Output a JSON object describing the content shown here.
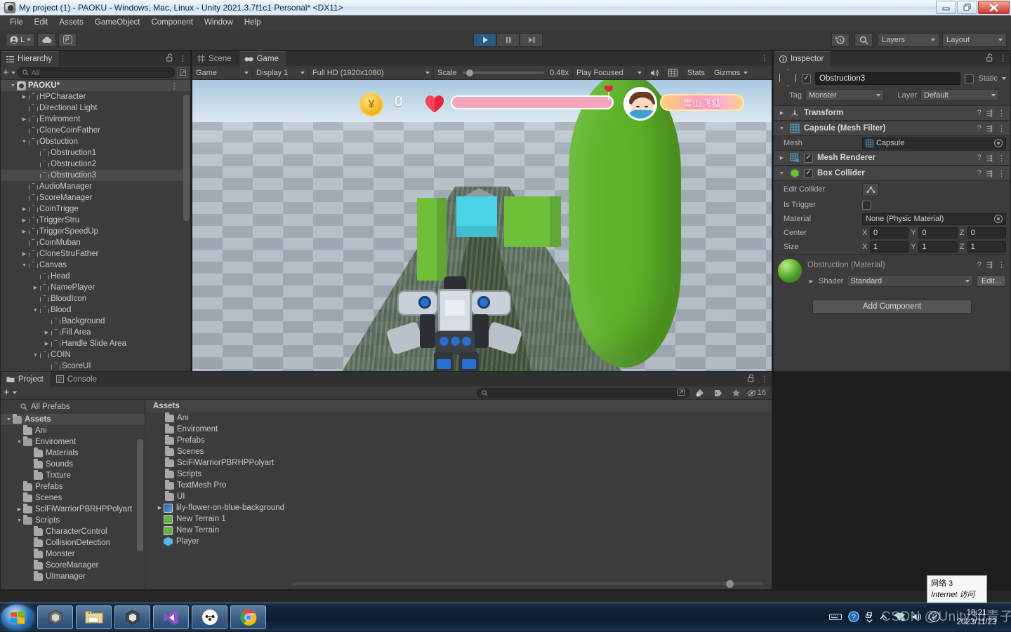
{
  "window": {
    "title": "My project (1) - PAOKU - Windows, Mac, Linux - Unity 2021.3.7f1c1 Personal* <DX11>",
    "minimize_label": "–",
    "restore_label": "❐",
    "close_label": "✕"
  },
  "menubar": {
    "items": [
      "File",
      "Edit",
      "Assets",
      "GameObject",
      "Component",
      "Window",
      "Help"
    ]
  },
  "toolbar": {
    "account_label": "L",
    "cloud_icon": "cloud-icon",
    "services_icon": "unity-services-icon",
    "play_icon": "▶",
    "pause_icon": "❚❚",
    "step_icon": "▶❚",
    "play_active": true,
    "history_icon": "undo-history-icon",
    "search_icon": "search-icon",
    "layers_label": "Layers",
    "layout_label": "Layout"
  },
  "hierarchy": {
    "tab_label": "Hierarchy",
    "tab_icon": "hierarchy-icon",
    "lock_icon": "lock-open-icon",
    "menu_icon": "kebab-menu-icon",
    "add_label": "+",
    "search_placeholder": "All",
    "items": [
      {
        "label": "PAOKU*",
        "depth": 0,
        "arrow": "down",
        "icon": "scene-icon",
        "selected": false,
        "root": true
      },
      {
        "label": "HPCharacter",
        "depth": 1,
        "arrow": "right",
        "icon": "gameobject-icon"
      },
      {
        "label": "Directional Light",
        "depth": 1,
        "arrow": "none",
        "icon": "gameobject-icon"
      },
      {
        "label": "Enviroment",
        "depth": 1,
        "arrow": "right",
        "icon": "gameobject-icon"
      },
      {
        "label": "CloneCoinFather",
        "depth": 1,
        "arrow": "none",
        "icon": "gameobject-icon"
      },
      {
        "label": "Obstuction",
        "depth": 1,
        "arrow": "down",
        "icon": "gameobject-icon"
      },
      {
        "label": "Obstruction1",
        "depth": 2,
        "arrow": "none",
        "icon": "gameobject-icon"
      },
      {
        "label": "Obstruction2",
        "depth": 2,
        "arrow": "none",
        "icon": "gameobject-icon"
      },
      {
        "label": "Obstruction3",
        "depth": 2,
        "arrow": "none",
        "icon": "gameobject-icon",
        "selected": true
      },
      {
        "label": "AudioManager",
        "depth": 1,
        "arrow": "none",
        "icon": "gameobject-icon"
      },
      {
        "label": "ScoreManager",
        "depth": 1,
        "arrow": "none",
        "icon": "gameobject-icon"
      },
      {
        "label": "CoinTrigge",
        "depth": 1,
        "arrow": "right",
        "icon": "gameobject-icon"
      },
      {
        "label": "TriggerStru",
        "depth": 1,
        "arrow": "right",
        "icon": "gameobject-icon"
      },
      {
        "label": "TriggerSpeedUp",
        "depth": 1,
        "arrow": "right",
        "icon": "gameobject-icon"
      },
      {
        "label": "CoinMuban",
        "depth": 1,
        "arrow": "none",
        "icon": "gameobject-icon"
      },
      {
        "label": "CloneStruFather",
        "depth": 1,
        "arrow": "right",
        "icon": "gameobject-icon"
      },
      {
        "label": "Canvas",
        "depth": 1,
        "arrow": "down",
        "icon": "gameobject-icon"
      },
      {
        "label": "Head",
        "depth": 2,
        "arrow": "none",
        "icon": "gameobject-icon"
      },
      {
        "label": "NamePlayer",
        "depth": 2,
        "arrow": "right",
        "icon": "gameobject-icon"
      },
      {
        "label": "BloodIcon",
        "depth": 2,
        "arrow": "none",
        "icon": "gameobject-icon"
      },
      {
        "label": "Blood",
        "depth": 2,
        "arrow": "down",
        "icon": "gameobject-icon"
      },
      {
        "label": "Background",
        "depth": 3,
        "arrow": "none",
        "icon": "gameobject-icon"
      },
      {
        "label": "Fill Area",
        "depth": 3,
        "arrow": "right",
        "icon": "gameobject-icon"
      },
      {
        "label": "Handle Slide Area",
        "depth": 3,
        "arrow": "right",
        "icon": "gameobject-icon"
      },
      {
        "label": "COIN",
        "depth": 2,
        "arrow": "down",
        "icon": "gameobject-icon"
      },
      {
        "label": "ScoreUI",
        "depth": 3,
        "arrow": "none",
        "icon": "gameobject-icon"
      }
    ]
  },
  "gameview": {
    "tabs": [
      {
        "label": "Scene",
        "icon": "scene-grid-icon",
        "active": false
      },
      {
        "label": "Game",
        "icon": "game-pad-icon",
        "active": true
      }
    ],
    "menu_icon": "kebab-menu-icon",
    "display_mode": "Game",
    "display_target": "Display 1",
    "resolution": "Full HD (1920x1080)",
    "scale_label": "Scale",
    "scale_value": "0.48x",
    "play_mode": "Play Focused",
    "mute_icon": "speaker-icon",
    "aspect_icon": "grid-icon",
    "stats_label": "Stats",
    "gizmos_label": "Gizmos",
    "hud": {
      "coin_icon": "¥",
      "score": "0",
      "heart_icon": "heart-icon",
      "health_percent": 100,
      "avatar_icon": "player-avatar-icon",
      "player_name": "雪山飞狐"
    }
  },
  "inspector": {
    "tab_label": "Inspector",
    "tab_icon": "info-icon",
    "lock_icon": "lock-open-icon",
    "menu_icon": "kebab-menu-icon",
    "object_enabled": true,
    "object_name": "Obstruction3",
    "static_label": "Static",
    "static_checked": false,
    "tag_label": "Tag",
    "tag_value": "Monster",
    "layer_label": "Layer",
    "layer_value": "Default",
    "components": [
      {
        "name": "Transform",
        "icon": "transform-icon",
        "expanded": false,
        "has_checkbox": false
      },
      {
        "name": "Capsule (Mesh Filter)",
        "icon": "mesh-filter-icon",
        "expanded": true,
        "has_checkbox": false
      },
      {
        "name": "Mesh Renderer",
        "icon": "mesh-renderer-icon",
        "expanded": false,
        "has_checkbox": true,
        "checked": true
      },
      {
        "name": "Box Collider",
        "icon": "box-collider-icon",
        "expanded": true,
        "has_checkbox": true,
        "checked": true
      }
    ],
    "mesh_label": "Mesh",
    "mesh_value": "Capsule",
    "edit_collider_label": "Edit Collider",
    "is_trigger_label": "Is Trigger",
    "is_trigger_checked": false,
    "material_label": "Material",
    "material_value": "None (Physic Material)",
    "center_label": "Center",
    "center": {
      "x": "0",
      "y": "0",
      "z": "0"
    },
    "size_label": "Size",
    "size": {
      "x": "1",
      "y": "1",
      "z": "1"
    },
    "material_block": {
      "title": "Obstruction (Material)",
      "shader_label": "Shader",
      "shader_value": "Standard",
      "edit_label": "Edit...",
      "ball_color": "#4ea32a"
    },
    "add_component_label": "Add Component",
    "help_icon": "help-icon",
    "preset_icon": "preset-icon",
    "kebab_icon": "kebab-menu-icon"
  },
  "project": {
    "tabs": [
      {
        "label": "Project",
        "icon": "folder-icon",
        "active": true
      },
      {
        "label": "Console",
        "icon": "console-icon",
        "active": false
      }
    ],
    "add_label": "+",
    "search_placeholder": "",
    "search_icon": "search-icon",
    "save_search_icon": "save-filter-icon",
    "type_filter_icon": "type-filter-icon",
    "label_filter_icon": "label-filter-icon",
    "favorite_icon": "star-icon",
    "hidden_count": "16",
    "hidden_icon": "eye-off-icon",
    "lock_icon": "lock-open-icon",
    "menu_icon": "kebab-menu-icon",
    "all_prefabs_label": "All Prefabs",
    "tree": [
      {
        "label": "Assets",
        "depth": 0,
        "arrow": "down",
        "selected": true
      },
      {
        "label": "Ani",
        "depth": 1,
        "arrow": "none"
      },
      {
        "label": "Enviroment",
        "depth": 1,
        "arrow": "down"
      },
      {
        "label": "Materials",
        "depth": 2,
        "arrow": "none"
      },
      {
        "label": "Sounds",
        "depth": 2,
        "arrow": "none"
      },
      {
        "label": "Trxture",
        "depth": 2,
        "arrow": "none"
      },
      {
        "label": "Prefabs",
        "depth": 1,
        "arrow": "none"
      },
      {
        "label": "Scenes",
        "depth": 1,
        "arrow": "none"
      },
      {
        "label": "SciFiWarriorPBRHPPolyart",
        "depth": 1,
        "arrow": "right"
      },
      {
        "label": "Scripts",
        "depth": 1,
        "arrow": "down"
      },
      {
        "label": "CharacterControl",
        "depth": 2,
        "arrow": "none"
      },
      {
        "label": "CollisionDetection",
        "depth": 2,
        "arrow": "none"
      },
      {
        "label": "Monster",
        "depth": 2,
        "arrow": "none"
      },
      {
        "label": "ScoreManager",
        "depth": 2,
        "arrow": "none"
      },
      {
        "label": "UImanager",
        "depth": 2,
        "arrow": "none"
      }
    ],
    "breadcrumb": "Assets",
    "assets": [
      {
        "label": "Ani",
        "type": "folder"
      },
      {
        "label": "Enviroment",
        "type": "folder"
      },
      {
        "label": "Prefabs",
        "type": "folder"
      },
      {
        "label": "Scenes",
        "type": "folder"
      },
      {
        "label": "SciFiWarriorPBRHPPolyart",
        "type": "folder"
      },
      {
        "label": "Scripts",
        "type": "folder"
      },
      {
        "label": "TextMesh Pro",
        "type": "folder"
      },
      {
        "label": "UI",
        "type": "folder"
      },
      {
        "label": "lily-flower-on-blue-background",
        "type": "image",
        "arrow": "right"
      },
      {
        "label": "New Terrain 1",
        "type": "terrain"
      },
      {
        "label": "New Terrain",
        "type": "terrain"
      },
      {
        "label": "Player",
        "type": "prefab"
      }
    ]
  },
  "taskbar": {
    "start_icon": "windows-start-icon",
    "items": [
      {
        "icon": "unity-icon",
        "name": "unity-hub"
      },
      {
        "icon": "explorer-icon",
        "name": "file-explorer"
      },
      {
        "icon": "unity-icon",
        "name": "unity-editor"
      },
      {
        "icon": "visual-studio-icon",
        "name": "visual-studio"
      },
      {
        "icon": "app-icon",
        "name": "app"
      },
      {
        "icon": "chrome-icon",
        "name": "google-chrome"
      }
    ],
    "tray": {
      "keyboard_icon": "keyboard-icon",
      "help_icon": "help-icon",
      "network_icon": "network-icon",
      "up_arrow_icon": "show-hidden-icons",
      "volume_icon": "volume-icon",
      "action_icon": "action-center-icon"
    },
    "clock_time": "10:21",
    "clock_date": "2023/11/23"
  },
  "tooltip": {
    "line1": "网络  3",
    "line2": "Internet 访问"
  },
  "watermark": "CSDN @Unity3d青子"
}
